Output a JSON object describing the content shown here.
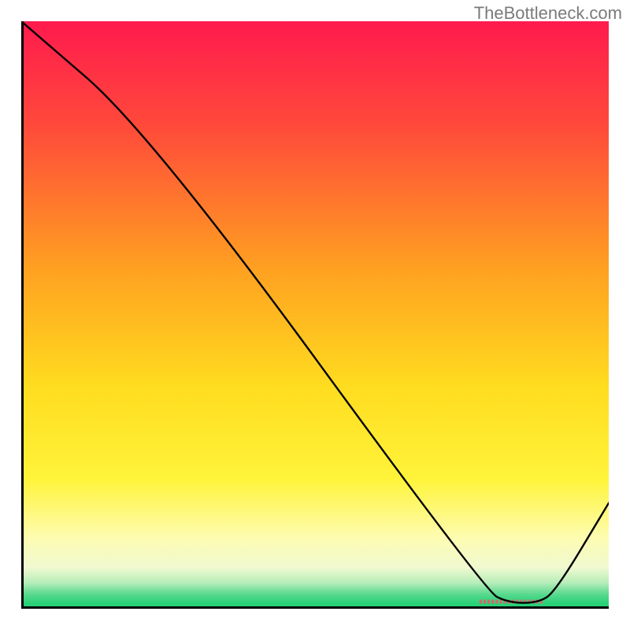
{
  "watermark": "TheBottleneck.com",
  "chart_data": {
    "type": "line",
    "title": "",
    "xlabel": "",
    "ylabel": "",
    "xlim": [
      0,
      100
    ],
    "ylim": [
      0,
      100
    ],
    "grid": false,
    "legend": false,
    "curve": {
      "x": [
        0,
        22,
        79,
        83,
        88,
        91,
        100
      ],
      "y": [
        100,
        81,
        3,
        1,
        1,
        3,
        18
      ]
    },
    "marker_band": {
      "x_start": 78,
      "x_end": 89,
      "y": 1.2,
      "color": "#d06a6a"
    },
    "background": {
      "description": "vertical gradient red→orange→yellow→pale-yellow→green with white below axis",
      "stops": [
        {
          "pos": 0.0,
          "color": "#ff1a4e"
        },
        {
          "pos": 0.18,
          "color": "#ff4a3a"
        },
        {
          "pos": 0.42,
          "color": "#ffa021"
        },
        {
          "pos": 0.62,
          "color": "#ffdc1f"
        },
        {
          "pos": 0.78,
          "color": "#fff43a"
        },
        {
          "pos": 0.88,
          "color": "#fdfcb2"
        },
        {
          "pos": 0.93,
          "color": "#f0f9d0"
        },
        {
          "pos": 0.955,
          "color": "#b9eebb"
        },
        {
          "pos": 0.975,
          "color": "#5ad98e"
        },
        {
          "pos": 0.99,
          "color": "#2bd27a"
        },
        {
          "pos": 1.0,
          "color": "#1fce74"
        }
      ]
    }
  }
}
